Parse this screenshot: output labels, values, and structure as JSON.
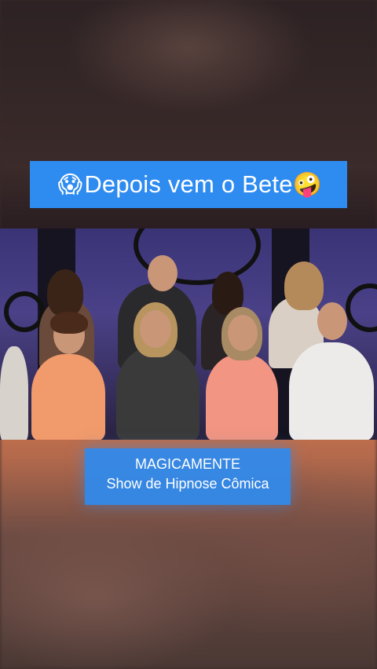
{
  "overlay": {
    "title_emoji_left": "😱",
    "title_text": "Depois vem o Bete",
    "title_emoji_right": "🤪"
  },
  "caption": {
    "line1": "MAGICAMENTE",
    "line2": "Show de Hipnose Cômica"
  },
  "colors": {
    "banner": "#2e8bf0",
    "text": "#ffffff"
  }
}
